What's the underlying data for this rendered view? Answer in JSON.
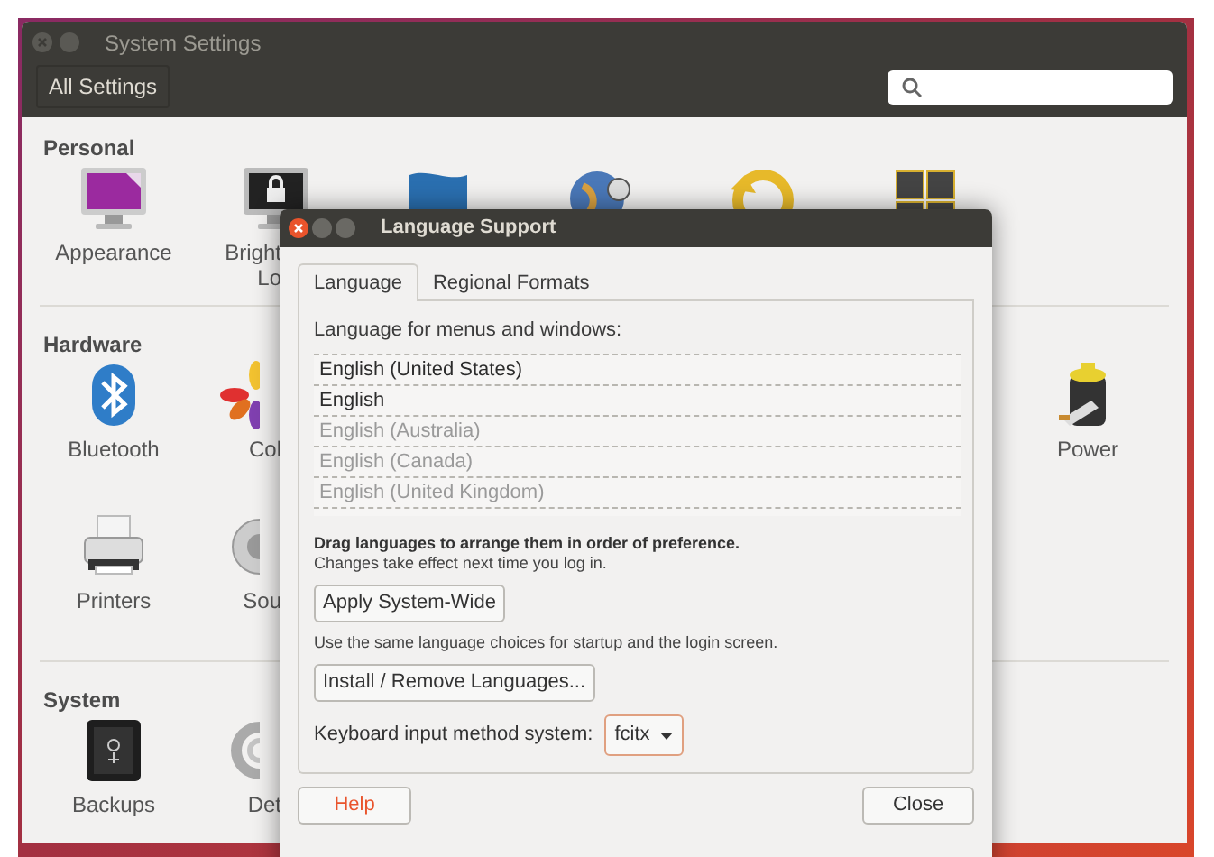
{
  "window": {
    "title": "System Settings",
    "toolbar_button": "All Settings"
  },
  "sections": [
    {
      "title": "Personal",
      "items": [
        {
          "kind": "appearance",
          "label": [
            "Appearance"
          ]
        },
        {
          "kind": "brightness",
          "label": [
            "Bright",
            "Lo"
          ]
        },
        {
          "kind": "shield"
        },
        {
          "kind": "globe"
        },
        {
          "kind": "restore"
        },
        {
          "kind": "workspaces"
        }
      ]
    },
    {
      "title": "Hardware",
      "items": [
        {
          "kind": "bluetooth",
          "label": [
            "Bluetooth"
          ]
        },
        {
          "kind": "color",
          "label": [
            "Col"
          ]
        },
        {
          "kind": "empty"
        },
        {
          "kind": "empty"
        },
        {
          "kind": "empty"
        },
        {
          "kind": "empty"
        },
        {
          "kind": "power",
          "label": [
            "Power"
          ]
        },
        {
          "kind": "printer",
          "label": [
            "Printers"
          ]
        },
        {
          "kind": "sound",
          "label": [
            "Sou"
          ]
        }
      ]
    },
    {
      "title": "System",
      "items": [
        {
          "kind": "backups",
          "label": [
            "Backups"
          ]
        },
        {
          "kind": "gear",
          "label": [
            "Det"
          ]
        }
      ]
    }
  ],
  "dialog": {
    "title": "Language Support",
    "tabs": [
      {
        "label": "Language",
        "selected": true
      },
      {
        "label": "Regional Formats",
        "selected": false
      }
    ],
    "list_label": "Language for menus and windows:",
    "languages": [
      {
        "name": "English (United States)",
        "dimmed": false
      },
      {
        "name": "English",
        "dimmed": false
      },
      {
        "name": "English (Australia)",
        "dimmed": true
      },
      {
        "name": "English (Canada)",
        "dimmed": true
      },
      {
        "name": "English (United Kingdom)",
        "dimmed": true
      }
    ],
    "hint_bold": "Drag languages to arrange them in order of preference.",
    "hint": "Changes take effect next time you log in.",
    "apply_button": "Apply System-Wide",
    "apply_note": "Use the same language choices for startup and the login screen.",
    "install_button": "Install / Remove Languages...",
    "input_method_label": "Keyboard input method system:",
    "input_method_value": "fcitx",
    "help_button": "Help",
    "close_button": "Close"
  }
}
